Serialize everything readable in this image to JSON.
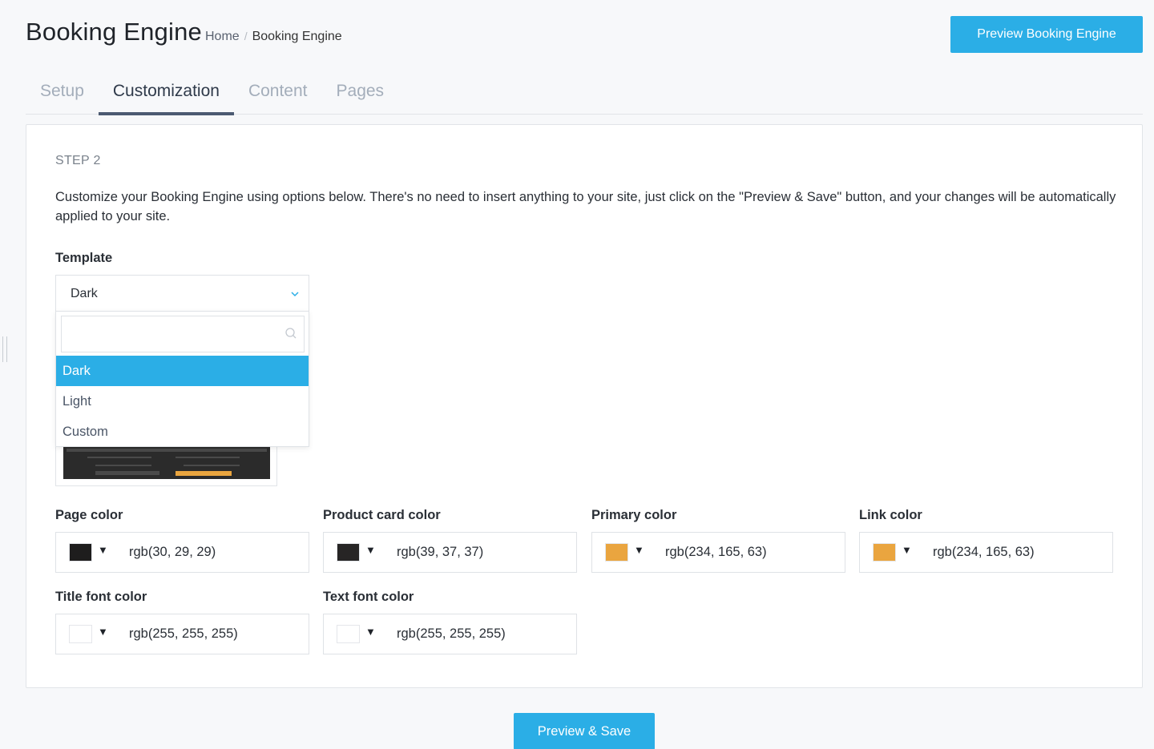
{
  "header": {
    "title": "Booking Engine",
    "breadcrumb": {
      "home": "Home",
      "separator": "/",
      "current": "Booking Engine"
    },
    "preview_button": "Preview Booking Engine"
  },
  "tabs": [
    {
      "label": "Setup",
      "active": false
    },
    {
      "label": "Customization",
      "active": true
    },
    {
      "label": "Content",
      "active": false
    },
    {
      "label": "Pages",
      "active": false
    }
  ],
  "step": {
    "label": "STEP 2",
    "description": "Customize your Booking Engine using options below. There's no need to insert anything to your site, just click on the \"Preview & Save\" button, and your changes will be automatically applied to your site."
  },
  "template": {
    "label": "Template",
    "selected": "Dark",
    "search_placeholder": "",
    "options": [
      "Dark",
      "Light",
      "Custom"
    ],
    "chevron_icon": "chevron-down-icon",
    "search_icon": "search-icon"
  },
  "colors": [
    {
      "label": "Page color",
      "value": "rgb(30, 29, 29)",
      "swatch": "#1e1d1d"
    },
    {
      "label": "Product card color",
      "value": "rgb(39, 37, 37)",
      "swatch": "#272525"
    },
    {
      "label": "Primary color",
      "value": "rgb(234, 165, 63)",
      "swatch": "#eaa53f"
    },
    {
      "label": "Link color",
      "value": "rgb(234, 165, 63)",
      "swatch": "#eaa53f"
    },
    {
      "label": "Title font color",
      "value": "rgb(255, 255, 255)",
      "swatch": "#ffffff"
    },
    {
      "label": "Text font color",
      "value": "rgb(255, 255, 255)",
      "swatch": "#ffffff"
    }
  ],
  "caret_glyph": "▼",
  "save_button": "Preview & Save",
  "theme": {
    "accent": "#2baee6",
    "tab_active_underline": "#4c5a72"
  }
}
